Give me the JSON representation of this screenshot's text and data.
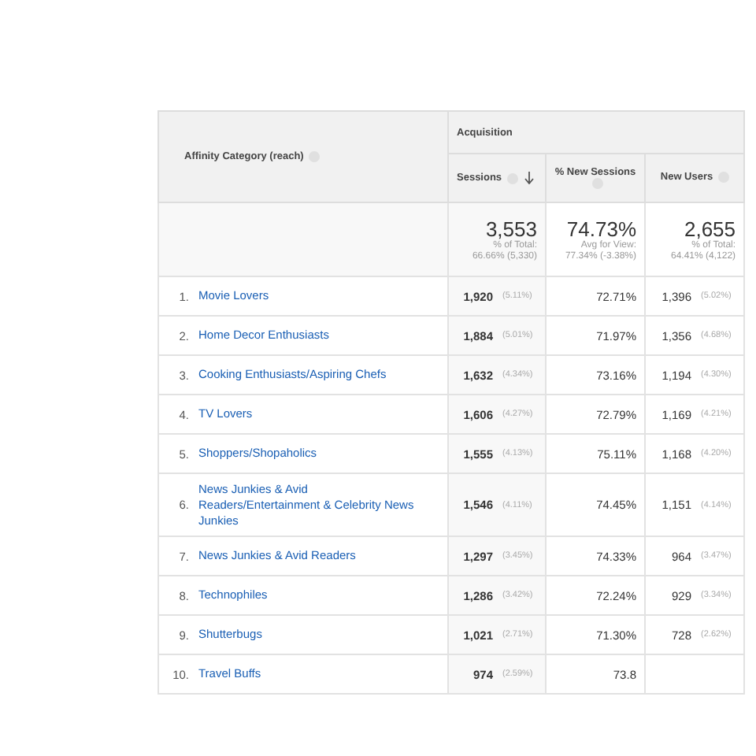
{
  "table": {
    "dimension_header": "Affinity Category (reach)",
    "group_header": "Acquisition",
    "columns": [
      {
        "label": "Sessions",
        "sorted": true
      },
      {
        "label": "% New Sessions",
        "sorted": false
      },
      {
        "label": "New Users",
        "sorted": false
      }
    ],
    "totals": [
      {
        "value": "3,553",
        "caption": "% of Total:",
        "detail": "66.66% (5,330)"
      },
      {
        "value": "74.73%",
        "caption": "Avg for View:",
        "detail": "77.34% (-3.38%)"
      },
      {
        "value": "2,655",
        "caption": "% of Total:",
        "detail": "64.41% (4,122)"
      }
    ],
    "rows": [
      {
        "index": "1.",
        "category": "Movie Lovers",
        "sessions": "1,920",
        "sessions_pct": "(5.11%)",
        "new_sessions": "72.71%",
        "new_users": "1,396",
        "new_users_pct": "(5.02%)"
      },
      {
        "index": "2.",
        "category": "Home Decor Enthusiasts",
        "sessions": "1,884",
        "sessions_pct": "(5.01%)",
        "new_sessions": "71.97%",
        "new_users": "1,356",
        "new_users_pct": "(4.68%)"
      },
      {
        "index": "3.",
        "category": "Cooking Enthusiasts/Aspiring Chefs",
        "sessions": "1,632",
        "sessions_pct": "(4.34%)",
        "new_sessions": "73.16%",
        "new_users": "1,194",
        "new_users_pct": "(4.30%)"
      },
      {
        "index": "4.",
        "category": "TV Lovers",
        "sessions": "1,606",
        "sessions_pct": "(4.27%)",
        "new_sessions": "72.79%",
        "new_users": "1,169",
        "new_users_pct": "(4.21%)"
      },
      {
        "index": "5.",
        "category": "Shoppers/Shopaholics",
        "sessions": "1,555",
        "sessions_pct": "(4.13%)",
        "new_sessions": "75.11%",
        "new_users": "1,168",
        "new_users_pct": "(4.20%)"
      },
      {
        "index": "6.",
        "category": "News Junkies & Avid Readers/Entertainment & Celebrity News Junkies",
        "sessions": "1,546",
        "sessions_pct": "(4.11%)",
        "new_sessions": "74.45%",
        "new_users": "1,151",
        "new_users_pct": "(4.14%)"
      },
      {
        "index": "7.",
        "category": "News Junkies & Avid Readers",
        "sessions": "1,297",
        "sessions_pct": "(3.45%)",
        "new_sessions": "74.33%",
        "new_users": "964",
        "new_users_pct": "(3.47%)"
      },
      {
        "index": "8.",
        "category": "Technophiles",
        "sessions": "1,286",
        "sessions_pct": "(3.42%)",
        "new_sessions": "72.24%",
        "new_users": "929",
        "new_users_pct": "(3.34%)"
      },
      {
        "index": "9.",
        "category": "Shutterbugs",
        "sessions": "1,021",
        "sessions_pct": "(2.71%)",
        "new_sessions": "71.30%",
        "new_users": "728",
        "new_users_pct": "(2.62%)"
      },
      {
        "index": "10.",
        "category": "Travel Buffs",
        "sessions": "974",
        "sessions_pct": "(2.59%)",
        "new_sessions": "73.8"
      }
    ]
  }
}
